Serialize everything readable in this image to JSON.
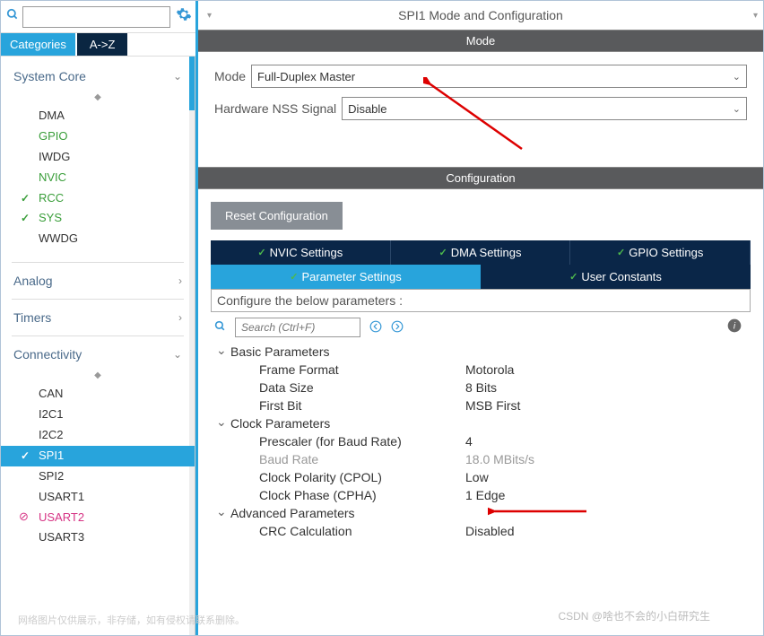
{
  "searchLeft": {
    "placeholder": ""
  },
  "tabs": {
    "categories": "Categories",
    "az": "A->Z"
  },
  "tree": {
    "systemCore": {
      "label": "System Core",
      "items": [
        {
          "label": "DMA",
          "cls": ""
        },
        {
          "label": "GPIO",
          "cls": "green"
        },
        {
          "label": "IWDG",
          "cls": ""
        },
        {
          "label": "NVIC",
          "cls": "green"
        },
        {
          "label": "RCC",
          "cls": "green",
          "check": true
        },
        {
          "label": "SYS",
          "cls": "green",
          "check": true
        },
        {
          "label": "WWDG",
          "cls": ""
        }
      ]
    },
    "analog": {
      "label": "Analog"
    },
    "timers": {
      "label": "Timers"
    },
    "connectivity": {
      "label": "Connectivity",
      "items": [
        {
          "label": "CAN",
          "cls": ""
        },
        {
          "label": "I2C1",
          "cls": ""
        },
        {
          "label": "I2C2",
          "cls": ""
        },
        {
          "label": "SPI1",
          "cls": "green",
          "check": true,
          "selected": true
        },
        {
          "label": "SPI2",
          "cls": ""
        },
        {
          "label": "USART1",
          "cls": ""
        },
        {
          "label": "USART2",
          "cls": "pink",
          "noentry": true
        },
        {
          "label": "USART3",
          "cls": ""
        }
      ]
    }
  },
  "title": "SPI1 Mode and Configuration",
  "modeHeader": "Mode",
  "modeRows": [
    {
      "label": "Mode",
      "value": "Full-Duplex Master"
    },
    {
      "label": "Hardware NSS Signal",
      "value": "Disable"
    }
  ],
  "configHeader": "Configuration",
  "resetBtn": "Reset Configuration",
  "configTabs1": [
    "NVIC Settings",
    "DMA Settings",
    "GPIO Settings"
  ],
  "configTabs2": [
    {
      "label": "Parameter Settings",
      "active": true
    },
    {
      "label": "User Constants",
      "active": false
    }
  ],
  "configInstruct": "Configure the below parameters :",
  "paramSearch": {
    "placeholder": "Search (Ctrl+F)"
  },
  "params": {
    "groups": [
      {
        "label": "Basic Parameters",
        "rows": [
          {
            "name": "Frame Format",
            "val": "Motorola"
          },
          {
            "name": "Data Size",
            "val": "8 Bits"
          },
          {
            "name": "First Bit",
            "val": "MSB First"
          }
        ]
      },
      {
        "label": "Clock Parameters",
        "rows": [
          {
            "name": "Prescaler (for Baud Rate)",
            "val": "4"
          },
          {
            "name": "Baud Rate",
            "val": "18.0 MBits/s",
            "gray": true
          },
          {
            "name": "Clock Polarity (CPOL)",
            "val": "Low"
          },
          {
            "name": "Clock Phase (CPHA)",
            "val": "1 Edge"
          }
        ]
      },
      {
        "label": "Advanced Parameters",
        "rows": [
          {
            "name": "CRC Calculation",
            "val": "Disabled"
          }
        ]
      }
    ]
  },
  "watermark1": "网络图片仅供展示，非存储，如有侵权请联系删除。",
  "watermark2": "CSDN @啥也不会的小白研究生"
}
